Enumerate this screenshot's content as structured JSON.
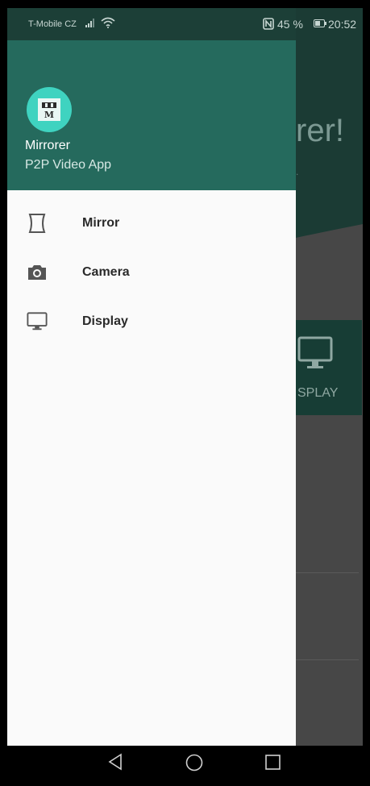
{
  "status_bar": {
    "carrier": "T-Mobile CZ",
    "battery_percent": "45 %",
    "time": "20:52",
    "icons": [
      "signal-icon",
      "wifi-icon",
      "nfc-icon",
      "battery-icon"
    ]
  },
  "drawer": {
    "app_name": "Mirrorer",
    "app_subtitle": "P2P Video App",
    "logo_icon": "mirrorer-logo-icon",
    "menu": [
      {
        "label": "Mirror",
        "icon": "mirror-icon"
      },
      {
        "label": "Camera",
        "icon": "camera-icon"
      },
      {
        "label": "Display",
        "icon": "monitor-icon"
      }
    ]
  },
  "background": {
    "title_fragment": "rer!",
    "display_button_label": "SPLAY"
  },
  "colors": {
    "primary": "#256a5d",
    "accent": "#3fd3c0",
    "drawer_bg": "#fafafa",
    "scrim_bg": "#474747"
  },
  "nav_bar": {
    "icons": [
      "back-icon",
      "home-icon",
      "recents-icon"
    ]
  }
}
